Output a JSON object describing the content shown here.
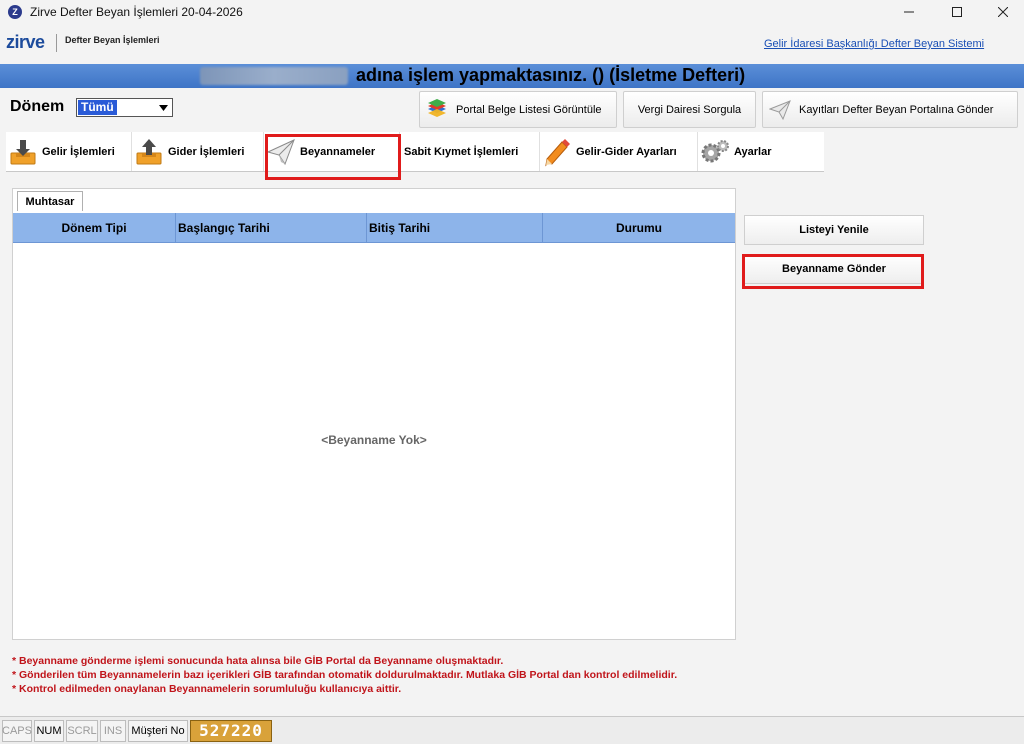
{
  "window": {
    "title": "Zirve Defter Beyan İşlemleri 20-04-2026",
    "app_icon_letter": "Z"
  },
  "header": {
    "logo": "zirve",
    "subtitle": "Defter Beyan İşlemleri",
    "gib_link": "Gelir İdaresi Başkanlığı Defter Beyan Sistemi"
  },
  "banner": {
    "text": "adına işlem yapmaktasınız. () (İsletme Defteri)"
  },
  "period": {
    "label": "Dönem",
    "selected": "Tümü"
  },
  "toolbar": {
    "portal_list": "Portal Belge Listesi Görüntüle",
    "vergi": "Vergi Dairesi Sorgula",
    "send_portal": "Kayıtları Defter Beyan Portalına Gönder"
  },
  "tabs": [
    {
      "label": "Gelir İşlemleri"
    },
    {
      "label": "Gider İşlemleri"
    },
    {
      "label": "Beyannameler"
    },
    {
      "label": "Sabit Kıymet İşlemleri"
    },
    {
      "label": "Gelir-Gider Ayarları"
    },
    {
      "label": "Ayarlar"
    }
  ],
  "panel": {
    "subtab": "Muhtasar",
    "columns": [
      "Dönem Tipi",
      "Başlangıç Tarihi",
      "Bitiş Tarihi",
      "Durumu"
    ],
    "empty_message": "<Beyanname Yok>"
  },
  "side_buttons": {
    "refresh": "Listeyi Yenile",
    "send": "Beyanname Gönder"
  },
  "notes": [
    "* Beyanname gönderme işlemi sonucunda hata alınsa bile GİB Portal da Beyanname oluşmaktadır.",
    "* Gönderilen tüm Beyannamelerin bazı içerikleri GİB tarafından otomatik doldurulmaktadır. Mutlaka GİB Portal dan kontrol edilmelidir.",
    "* Kontrol edilmeden onaylanan Beyannamelerin sorumluluğu kullanıcıya aittir."
  ],
  "status": {
    "caps": "CAPS",
    "num": "NUM",
    "scrl": "SCRL",
    "ins": "INS",
    "musteri_label": "Müşteri No",
    "musteri_no": "527220"
  },
  "colors": {
    "banner": "#4a80cf",
    "table_header": "#8db4ea",
    "highlight": "#e01b1b",
    "note_text": "#c0141a",
    "customer_no_bg": "#d9a23a"
  }
}
